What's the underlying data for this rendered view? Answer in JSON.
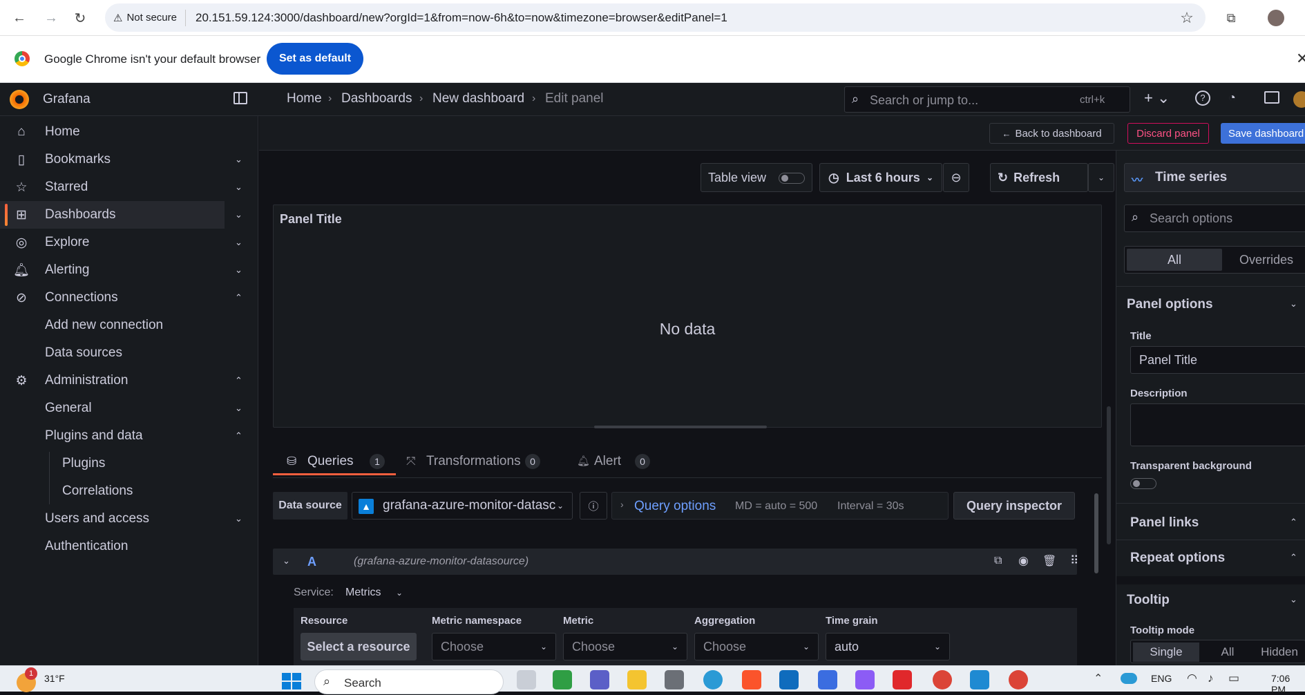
{
  "browser": {
    "security_label": "Not secure",
    "url": "20.151.59.124:3000/dashboard/new?orgId=1&from=now-6h&to=now&timezone=browser&editPanel=1",
    "default_bar_message": "Google Chrome isn't your default browser",
    "set_default_label": "Set as default"
  },
  "grafana": {
    "brand": "Grafana",
    "breadcrumb": [
      "Home",
      "Dashboards",
      "New dashboard",
      "Edit panel"
    ],
    "search_placeholder": "Search or jump to...",
    "search_shortcut": "ctrl+k",
    "back_to_dashboard": "Back to dashboard",
    "discard_panel": "Discard panel",
    "save_dashboard": "Save dashboard"
  },
  "sidebar": {
    "items": [
      {
        "label": "Home",
        "icon": "home-icon"
      },
      {
        "label": "Bookmarks",
        "icon": "bookmark-icon"
      },
      {
        "label": "Starred",
        "icon": "star-icon"
      },
      {
        "label": "Dashboards",
        "icon": "apps-icon"
      },
      {
        "label": "Explore",
        "icon": "compass-icon"
      },
      {
        "label": "Alerting",
        "icon": "bell-icon"
      },
      {
        "label": "Connections",
        "icon": "link-icon"
      },
      {
        "label": "Add new connection"
      },
      {
        "label": "Data sources"
      },
      {
        "label": "Administration",
        "icon": "cog-icon"
      },
      {
        "label": "General"
      },
      {
        "label": "Plugins and data"
      },
      {
        "label": "Plugins"
      },
      {
        "label": "Correlations"
      },
      {
        "label": "Users and access"
      },
      {
        "label": "Authentication"
      }
    ]
  },
  "toolbar": {
    "table_view": "Table view",
    "time_range": "Last 6 hours",
    "refresh": "Refresh"
  },
  "panel": {
    "title": "Panel Title",
    "empty": "No data"
  },
  "tabs": [
    {
      "label": "Queries",
      "count": "1"
    },
    {
      "label": "Transformations",
      "count": "0"
    },
    {
      "label": "Alert",
      "count": "0"
    }
  ],
  "query": {
    "data_source_label": "Data source",
    "data_source_value": "grafana-azure-monitor-datasc",
    "query_options": "Query options",
    "md": "MD = auto = 500",
    "interval": "Interval = 30s",
    "inspector": "Query inspector",
    "ref_id": "A",
    "ref_source": "(grafana-azure-monitor-datasource)",
    "service_label": "Service:",
    "service_value": "Metrics",
    "fields": [
      {
        "label": "Resource",
        "value": "Select a resource"
      },
      {
        "label": "Metric namespace",
        "value": "Choose"
      },
      {
        "label": "Metric",
        "value": "Choose"
      },
      {
        "label": "Aggregation",
        "value": "Choose"
      },
      {
        "label": "Time grain",
        "value": "auto"
      }
    ]
  },
  "options": {
    "visualization": "Time series",
    "search_placeholder": "Search options",
    "tab_all": "All",
    "tab_overrides": "Overrides",
    "panel_options": "Panel options",
    "title_label": "Title",
    "title_value": "Panel Title",
    "description_label": "Description",
    "transparent_label": "Transparent background",
    "panel_links": "Panel links",
    "repeat_options": "Repeat options",
    "tooltip": "Tooltip",
    "tooltip_mode": "Tooltip mode",
    "tooltip_modes": [
      "Single",
      "All",
      "Hidden"
    ]
  },
  "taskbar": {
    "temperature": "31°F",
    "weather_badge": "1",
    "search": "Search",
    "language": "ENG",
    "time": "7:06 PM"
  }
}
